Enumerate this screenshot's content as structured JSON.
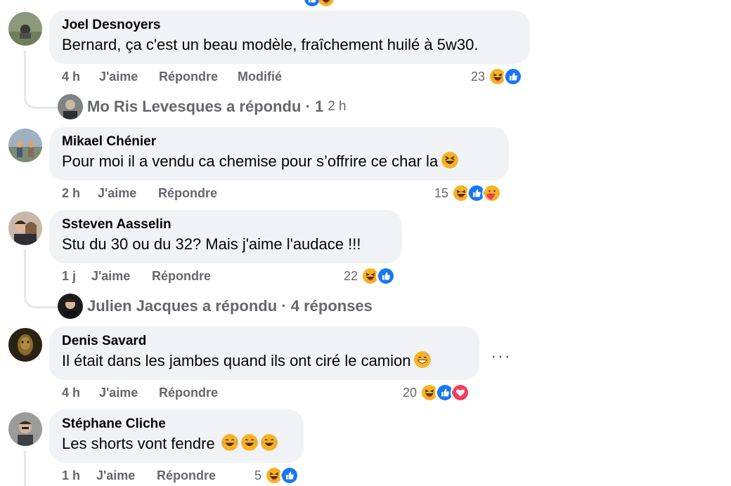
{
  "comments": [
    {
      "author": "Joel Desnoyers",
      "text": "Bernard, ça c'est un beau modèle, fraîchement huilé à 5w30.",
      "time": "4 h",
      "like": "J'aime",
      "reply": "Répondre",
      "edited": "Modifié",
      "reaction_count": "23",
      "reactions": [
        "haha",
        "like"
      ]
    },
    {
      "author": "Mikael Chénier",
      "text": "Pour moi il a vendu ca chemise pour s’offrire ce char la",
      "time": "2 h",
      "like": "J'aime",
      "reply": "Répondre",
      "reaction_count": "15",
      "reactions": [
        "haha",
        "like",
        "care"
      ]
    },
    {
      "author": "Ssteven Aasselin",
      "text": "Stu du 30 ou du 32? Mais j'aime l'audace !!!",
      "time": "1 j",
      "like": "J'aime",
      "reply": "Répondre",
      "reaction_count": "22",
      "reactions": [
        "haha",
        "like"
      ]
    },
    {
      "author": "Denis Savard",
      "text": "Il était dans les jambes quand ils ont ciré le camion",
      "time": "4 h",
      "like": "J'aime",
      "reply": "Répondre",
      "reaction_count": "20",
      "reactions": [
        "haha",
        "like",
        "love"
      ]
    },
    {
      "author": "Stéphane Cliche",
      "text": "Les shorts vont fendre",
      "time": "1 h",
      "like": "J'aime",
      "reply": "Répondre",
      "reaction_count": "5",
      "reactions": [
        "haha",
        "like"
      ]
    }
  ],
  "replies": [
    {
      "text": "Mo Ris Levesques a répondu · 1",
      "time": "2 h"
    },
    {
      "text": "Julien Jacques a répondu · 4 réponses",
      "time": ""
    }
  ],
  "more_label": "···",
  "colors": {
    "like_blue": "#1877f2",
    "love_red": "#f33e58",
    "haha_yellow": "#f7b125",
    "meta_gray": "#65676b",
    "bubble_bg": "#f0f2f5"
  }
}
